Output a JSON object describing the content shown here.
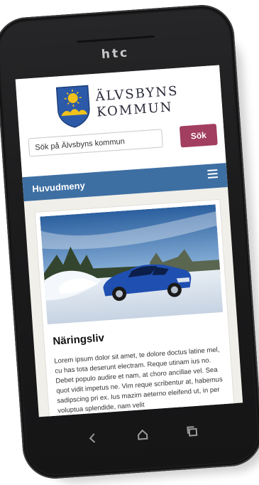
{
  "device": {
    "brand": "htc"
  },
  "header": {
    "logo_line1": "ÄLVSBYNS",
    "logo_line2": "KOMMUN"
  },
  "search": {
    "placeholder": "Sök på Älvsbyns kommun",
    "button_label": "Sök"
  },
  "menu": {
    "label": "Huvudmeny"
  },
  "article": {
    "title": "Näringsliv",
    "body": "Lorem ipsum dolor sit amet, te dolore doctus latine mel, cu has tota deserunt electram. Reque utinam ius no. Debet populo audire et nam, at choro ancillae vel. Sea quot vidit impetus ne. Vim reque scribentur at, habemus sadipscing pri ex. Ius mazim aeterno eleifend ut, in per voluptua splendide, nam velit"
  },
  "colors": {
    "accent_blue": "#3e6fa3",
    "search_button": "#a23e60",
    "phone_body": "#1b1b1c"
  },
  "icons": [
    "hamburger-icon",
    "back-icon",
    "home-icon",
    "recent-apps-icon",
    "crest-icon"
  ]
}
